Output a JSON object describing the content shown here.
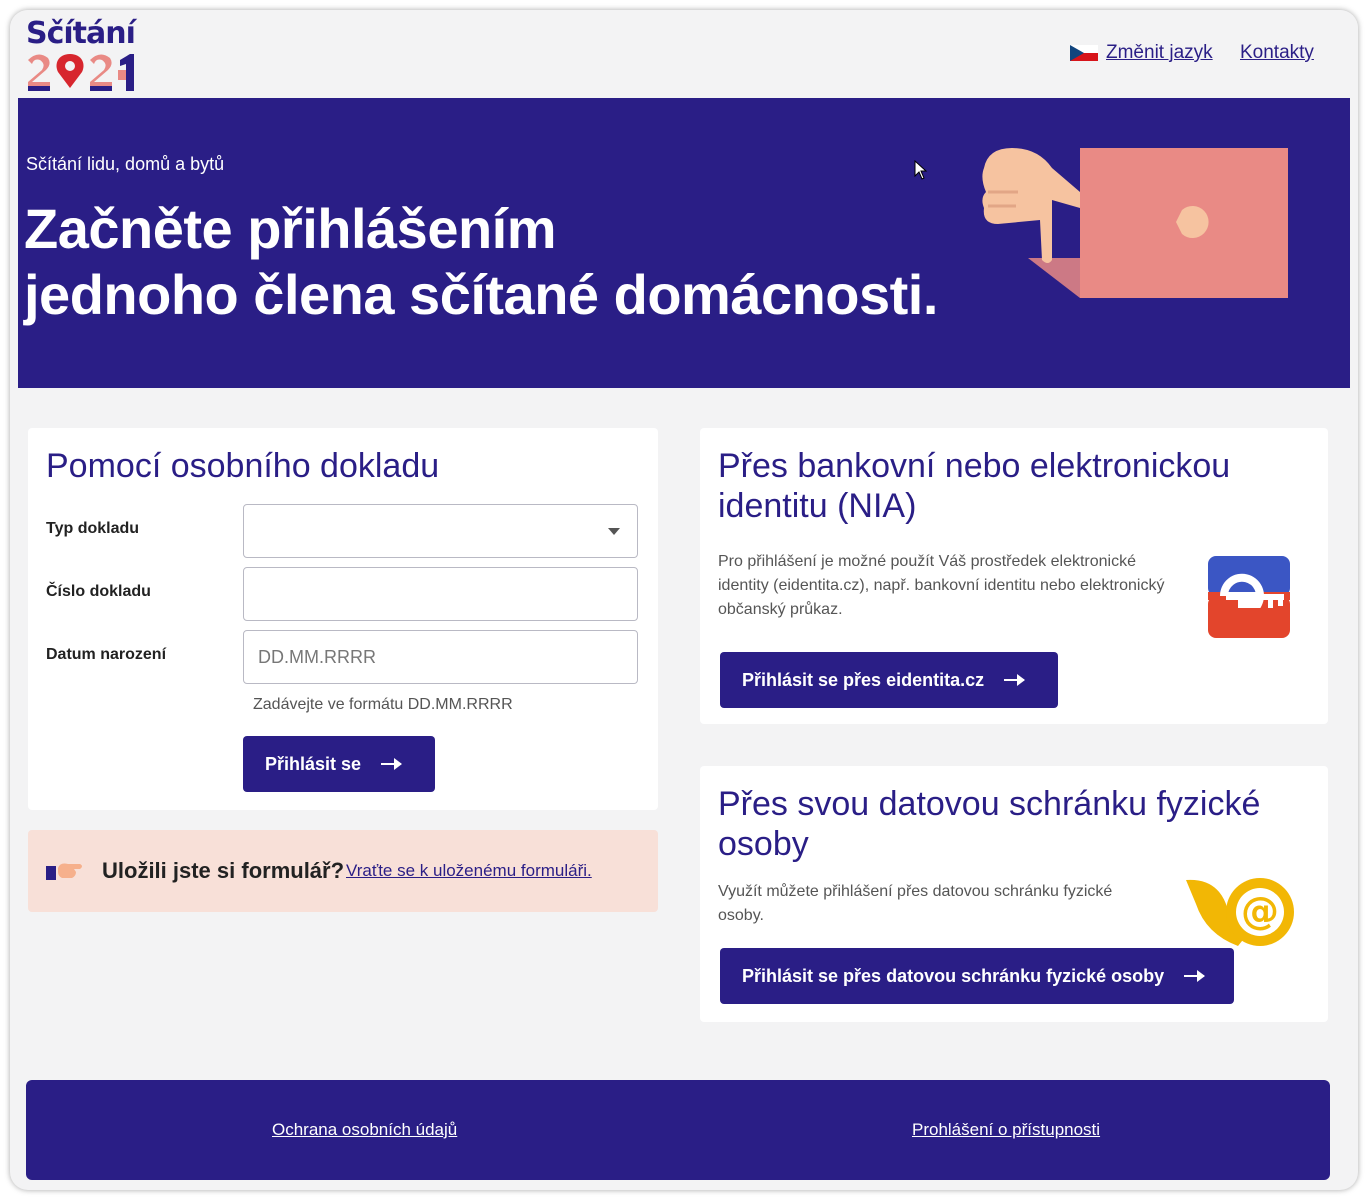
{
  "header": {
    "logo_text": "Sčítání",
    "logo_year": "2021",
    "change_language": "Změnit jazyk",
    "contacts": "Kontakty"
  },
  "hero": {
    "kicker": "Sčítání lidu, domů a bytů",
    "title_line1": "Začněte přihlášením",
    "title_line2": "jednoho člena sčítané domácnosti."
  },
  "document_login": {
    "title": "Pomocí osobního dokladu",
    "fields": [
      {
        "label": "Typ dokladu",
        "value": "",
        "placeholder": ""
      },
      {
        "label": "Číslo dokladu",
        "value": "",
        "placeholder": ""
      },
      {
        "label": "Datum narození",
        "value": "",
        "placeholder": "DD.MM.RRRR"
      }
    ],
    "hint": "Zadávejte ve formátu DD.MM.RRRR",
    "submit_label": "Přihlásit se"
  },
  "saved_form": {
    "question": "Uložili jste si formulář?",
    "link": "Vraťte se k uloženému formuláři."
  },
  "nia_login": {
    "title": "Přes bankovní nebo elektronickou identitu (NIA)",
    "text": "Pro přihlášení je možné použít Váš prostředek elektronické identity (eidentita.cz), např. bankovní identitu nebo elektronický občanský průkaz.",
    "button_label": "Přihlásit se přes eidentita.cz",
    "icon": "eidentita-icon"
  },
  "databox_login": {
    "title": "Přes svou datovou schránku fyzické osoby",
    "text": "Využít můžete přihlášení přes datovou schránku fyzické osoby.",
    "button_label": "Přihlásit se přes datovou schránku fyzické osoby",
    "icon": "datova-schranka-icon"
  },
  "footer": {
    "privacy": "Ochrana osobních údajů",
    "accessibility": "Prohlášení o přístupnosti"
  },
  "colors": {
    "brand": "#2a1e86",
    "background": "#f3f3f4",
    "accent_salmon": "#e98a85",
    "saved_banner": "#f8e0d8",
    "hand": "#f6c3a0"
  }
}
